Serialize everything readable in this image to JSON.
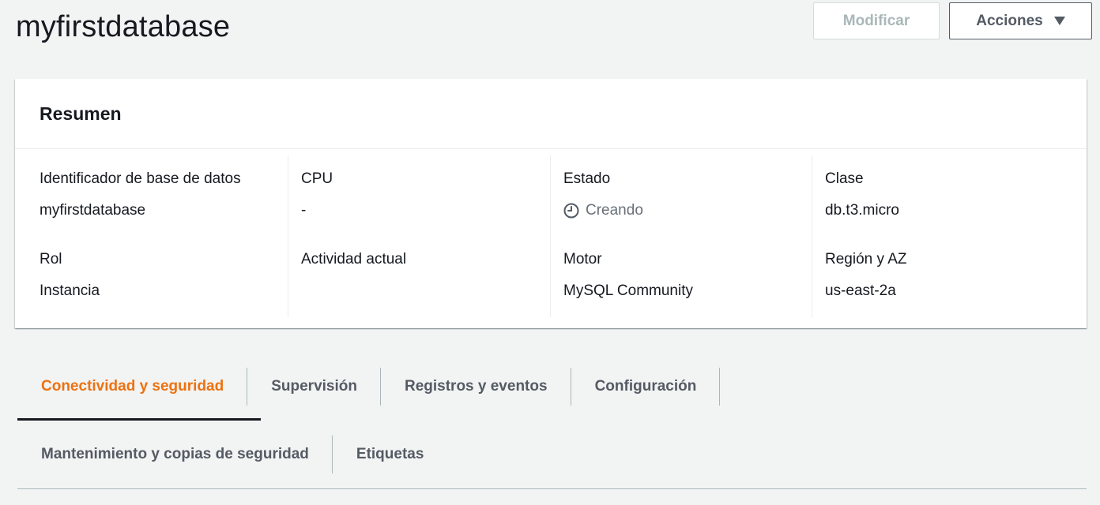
{
  "header": {
    "title": "myfirstdatabase",
    "modify_label": "Modificar",
    "actions_label": "Acciones"
  },
  "summary": {
    "title": "Resumen",
    "identifier_label": "Identificador de base de datos",
    "identifier_value": "myfirstdatabase",
    "role_label": "Rol",
    "role_value": "Instancia",
    "cpu_label": "CPU",
    "cpu_value": "-",
    "activity_label": "Actividad actual",
    "status_label": "Estado",
    "status_value": "Creando",
    "engine_label": "Motor",
    "engine_value": "MySQL Community",
    "class_label": "Clase",
    "class_value": "db.t3.micro",
    "region_label": "Región y AZ",
    "region_value": "us-east-2a"
  },
  "tabs": [
    {
      "label": "Conectividad y seguridad",
      "active": true
    },
    {
      "label": "Supervisión",
      "active": false
    },
    {
      "label": "Registros y eventos",
      "active": false
    },
    {
      "label": "Configuración",
      "active": false
    },
    {
      "label": "Mantenimiento y copias de seguridad",
      "active": false
    },
    {
      "label": "Etiquetas",
      "active": false
    }
  ],
  "colors": {
    "accent": "#ec7211",
    "status_text": "#687078",
    "background": "#f2f3f3"
  },
  "icons": {
    "status": "clock-icon",
    "actions_dropdown": "caret-down-icon"
  }
}
